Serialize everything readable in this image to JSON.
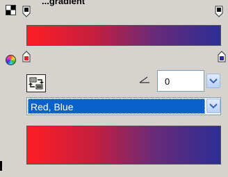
{
  "header": {
    "title": "...gradient"
  },
  "top_gradient": {
    "stops": [
      {
        "color": "#ff1d25"
      },
      {
        "color": "#2c2e94"
      }
    ]
  },
  "color_stops": {
    "left": {
      "color": "#ff1d25"
    },
    "right": {
      "color": "#2c2e94"
    }
  },
  "angle": {
    "label_icon": "angle-icon",
    "value": "0"
  },
  "preset": {
    "selected": "Red, Blue"
  },
  "colors": {
    "red": "#ff1d25",
    "blue": "#2c2e94",
    "selection": "#0b61c9"
  }
}
